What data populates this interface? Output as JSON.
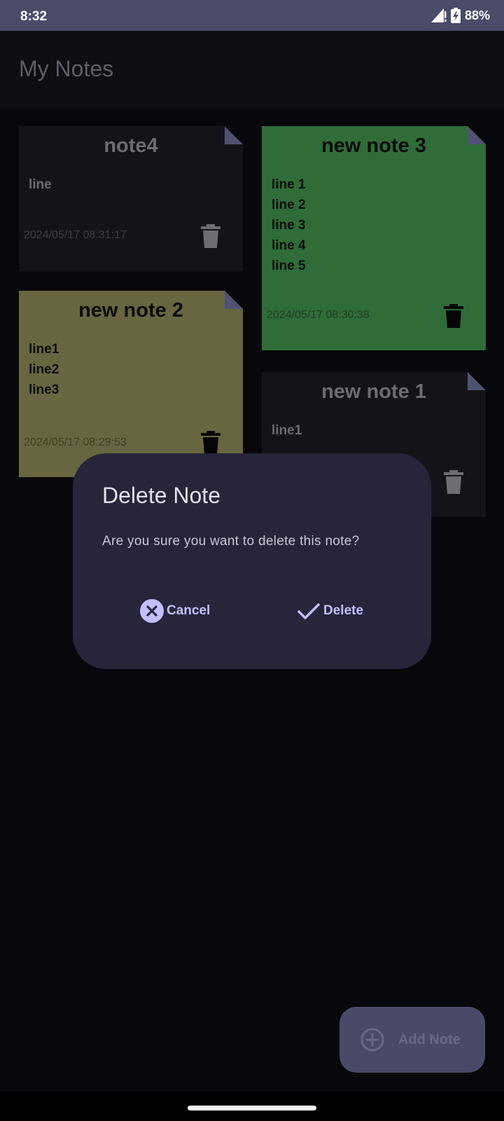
{
  "status_bar": {
    "time": "8:32",
    "battery": "88%"
  },
  "app_bar": {
    "title": "My Notes"
  },
  "notes": [
    {
      "title": "note4",
      "lines": [
        "line"
      ],
      "date": "2024/05/17 08:31:17",
      "color": "#131319"
    },
    {
      "title": "new note 3",
      "lines": [
        "line 1",
        "line 2",
        "line 3",
        "line 4",
        "line 5"
      ],
      "date": "2024/05/17 08:30:38",
      "color": "#2f6c38"
    },
    {
      "title": "new note 2",
      "lines": [
        "line1",
        "line2",
        "line3"
      ],
      "date": "2024/05/17 08:29:53",
      "color": "#676640"
    },
    {
      "title": "new note 1",
      "lines": [
        "line1"
      ],
      "date": "",
      "color": "#131319"
    }
  ],
  "dialog": {
    "title": "Delete Note",
    "message": "Are you sure you want to delete this note?",
    "cancel_label": "Cancel",
    "delete_label": "Delete"
  },
  "fab": {
    "label": "Add Note",
    "icon": "add-circle-icon"
  },
  "colors": {
    "accent": "#c3c0ff",
    "dialog_bg": "#26253a",
    "status_bar_bg": "#4a4b69"
  }
}
